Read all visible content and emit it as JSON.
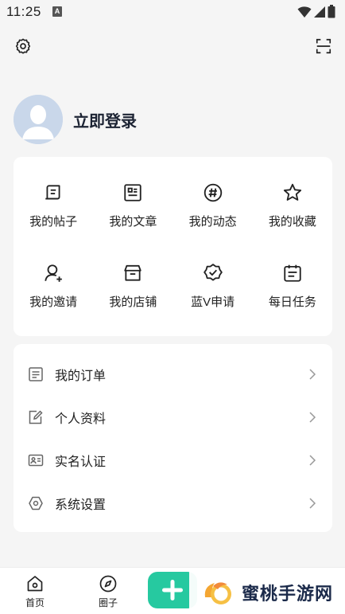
{
  "status": {
    "time": "11:25",
    "a_badge": "A"
  },
  "profile": {
    "login_label": "立即登录"
  },
  "grid": {
    "items": [
      {
        "label": "我的帖子",
        "icon": "post-icon"
      },
      {
        "label": "我的文章",
        "icon": "article-icon"
      },
      {
        "label": "我的动态",
        "icon": "hashtag-icon"
      },
      {
        "label": "我的收藏",
        "icon": "star-icon"
      },
      {
        "label": "我的邀请",
        "icon": "invite-user-icon"
      },
      {
        "label": "我的店铺",
        "icon": "store-icon"
      },
      {
        "label": "蓝V申请",
        "icon": "verified-badge-icon"
      },
      {
        "label": "每日任务",
        "icon": "calendar-icon"
      }
    ]
  },
  "list": {
    "items": [
      {
        "label": "我的订单",
        "icon": "order-list-icon"
      },
      {
        "label": "个人资料",
        "icon": "edit-profile-icon"
      },
      {
        "label": "实名认证",
        "icon": "id-card-icon"
      },
      {
        "label": "系统设置",
        "icon": "settings-hex-icon"
      }
    ]
  },
  "nav": {
    "home_label": "首页",
    "circle_label": "圈子"
  },
  "watermark": {
    "text": "蜜桃手游网"
  },
  "colors": {
    "accent": "#26c9a0",
    "background": "#f5f5f5",
    "card": "#ffffff",
    "title": "#1c2333"
  }
}
